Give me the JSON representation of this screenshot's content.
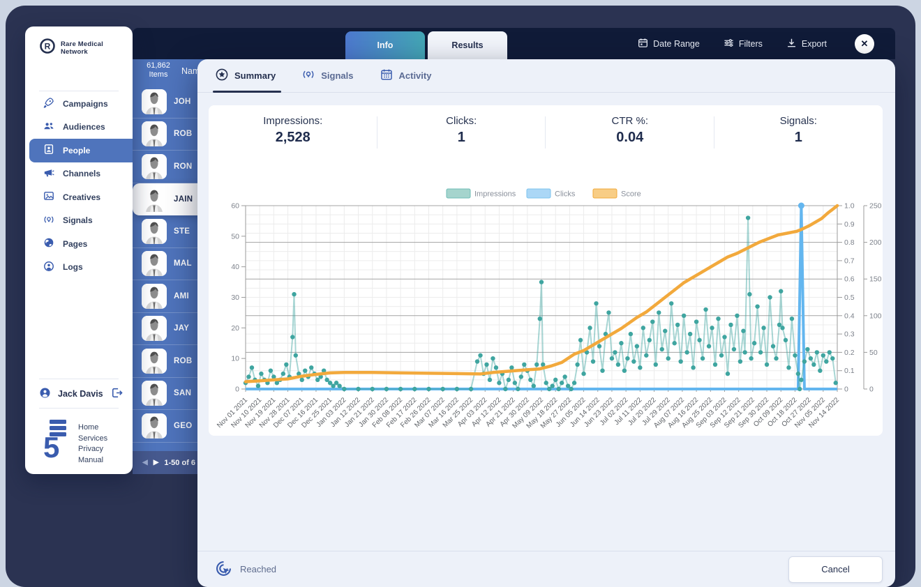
{
  "app": {
    "brand": "Rare Medical Network",
    "user_name": "Jack Davis",
    "footer_links": [
      "Home",
      "Services",
      "Privacy",
      "Manual"
    ],
    "accent_blue": "#4f74bc",
    "dark_navy": "#101b38"
  },
  "sidebar": {
    "items": [
      {
        "label": "Campaigns",
        "icon": "rocket-icon",
        "active": false
      },
      {
        "label": "Audiences",
        "icon": "audiences-icon",
        "active": false
      },
      {
        "label": "People",
        "icon": "people-badge-icon",
        "active": true
      },
      {
        "label": "Channels",
        "icon": "megaphone-icon",
        "active": false
      },
      {
        "label": "Creatives",
        "icon": "image-icon",
        "active": false
      },
      {
        "label": "Signals",
        "icon": "lightbulb-icon",
        "active": false
      },
      {
        "label": "Pages",
        "icon": "globe-icon",
        "active": false
      },
      {
        "label": "Logs",
        "icon": "person-circle-icon",
        "active": false
      }
    ]
  },
  "people_list": {
    "items_count": "61,862",
    "items_label": "Items",
    "column_header": "Nam",
    "rows": [
      {
        "name": "JOH",
        "selected": false
      },
      {
        "name": "ROB",
        "selected": false
      },
      {
        "name": "RON",
        "selected": false
      },
      {
        "name": "JAIN",
        "selected": true
      },
      {
        "name": "STE",
        "selected": false
      },
      {
        "name": "MAL",
        "selected": false
      },
      {
        "name": "AMI",
        "selected": false
      },
      {
        "name": "JAY",
        "selected": false
      },
      {
        "name": "ROB",
        "selected": false
      },
      {
        "name": "SAN",
        "selected": false
      },
      {
        "name": "GEO",
        "selected": false
      }
    ],
    "pagination": "1-50 of 6"
  },
  "header": {
    "tabs": [
      {
        "label": "Info",
        "active": true
      },
      {
        "label": "Results",
        "active": false
      }
    ],
    "actions": [
      {
        "label": "Date Range",
        "icon": "calendar-icon"
      },
      {
        "label": "Filters",
        "icon": "filters-icon"
      },
      {
        "label": "Export",
        "icon": "download-icon"
      }
    ],
    "close_glyph": "✕"
  },
  "results_panel": {
    "tabs": [
      {
        "label": "Summary",
        "icon": "star-badge-icon",
        "active": true
      },
      {
        "label": "Signals",
        "icon": "lightbulb-icon",
        "active": false
      },
      {
        "label": "Activity",
        "icon": "calendar-grid-icon",
        "active": false
      }
    ],
    "stats": [
      {
        "label": "Impressions:",
        "value": "2,528"
      },
      {
        "label": "Clicks:",
        "value": "1"
      },
      {
        "label": "CTR %:",
        "value": "0.04"
      },
      {
        "label": "Signals:",
        "value": "1"
      }
    ],
    "footer": {
      "status_label": "Reached",
      "cancel_label": "Cancel"
    }
  },
  "chart_data": {
    "type": "line",
    "x_domain_days": [
      0,
      378
    ],
    "x_tick_labels": [
      "Nov 01 2021",
      "Nov 10 2021",
      "Nov 19 2021",
      "Nov 28 2021",
      "Dec 07 2021",
      "Dec 16 2021",
      "Dec 25 2021",
      "Jan 03 2022",
      "Jan 12 2022",
      "Jan 21 2022",
      "Jan 30 2022",
      "Feb 08 2022",
      "Feb 17 2022",
      "Feb 26 2022",
      "Mar 07 2022",
      "Mar 16 2022",
      "Mar 25 2022",
      "Apr 03 2022",
      "Apr 12 2022",
      "Apr 21 2022",
      "Apr 30 2022",
      "May 09 2022",
      "May 18 2022",
      "May 27 2022",
      "Jun 05 2022",
      "Jun 14 2022",
      "Jun 23 2022",
      "Jul 02 2022",
      "Jul 11 2022",
      "Jul 20 2022",
      "Jul 29 2022",
      "Aug 07 2022",
      "Aug 16 2022",
      "Aug 25 2022",
      "Sep 03 2022",
      "Sep 12 2022",
      "Sep 21 2022",
      "Sep 30 2022",
      "Oct 09 2022",
      "Oct 18 2022",
      "Oct 27 2022",
      "Nov 05 2022",
      "Nov 14 2022"
    ],
    "axes": {
      "left": {
        "min": 0,
        "max": 60,
        "tick_labels": [
          "0",
          "10",
          "20",
          "30",
          "40",
          "50",
          "60"
        ]
      },
      "right_score": {
        "min": 0,
        "max": 1,
        "tick_labels": [
          "0",
          "0.1",
          "0.2",
          "0.3",
          "0.4",
          "0.5",
          "0.6",
          "0.7",
          "0.8",
          "0.9",
          "1.0"
        ]
      },
      "right_outer": {
        "min": 0,
        "max": 250,
        "tick_labels": [
          "0",
          "50",
          "100",
          "150",
          "200",
          "250"
        ]
      }
    },
    "grid": {
      "h_light_step": 0.05,
      "h_dark_levels": [
        0.2,
        0.4,
        0.6,
        0.8,
        1.0
      ]
    },
    "legend": [
      {
        "name": "Impressions",
        "fill": "#a5d4cd",
        "stroke": "#6fbdb6"
      },
      {
        "name": "Clicks",
        "fill": "#abd7f6",
        "stroke": "#7cc3ee"
      },
      {
        "name": "Score",
        "fill": "#f8cd85",
        "stroke": "#f0a93a"
      }
    ],
    "series": {
      "impressions": {
        "axis": "left",
        "dot_color": "#3fa5a0",
        "line_color": "rgba(63,165,160,0.45)",
        "points": [
          [
            0,
            2
          ],
          [
            2,
            4
          ],
          [
            4,
            7
          ],
          [
            6,
            3
          ],
          [
            8,
            1
          ],
          [
            10,
            5
          ],
          [
            12,
            3
          ],
          [
            14,
            2
          ],
          [
            16,
            6
          ],
          [
            18,
            4
          ],
          [
            20,
            2
          ],
          [
            22,
            3
          ],
          [
            24,
            5
          ],
          [
            26,
            8
          ],
          [
            28,
            4
          ],
          [
            30,
            17
          ],
          [
            31,
            31
          ],
          [
            32,
            11
          ],
          [
            34,
            5
          ],
          [
            36,
            3
          ],
          [
            38,
            6
          ],
          [
            40,
            4
          ],
          [
            42,
            7
          ],
          [
            44,
            5
          ],
          [
            46,
            3
          ],
          [
            48,
            4
          ],
          [
            50,
            6
          ],
          [
            52,
            3
          ],
          [
            54,
            2
          ],
          [
            56,
            1
          ],
          [
            58,
            2
          ],
          [
            60,
            1
          ],
          [
            63,
            0
          ],
          [
            72,
            0
          ],
          [
            81,
            0
          ],
          [
            90,
            0
          ],
          [
            99,
            0
          ],
          [
            108,
            0
          ],
          [
            117,
            0
          ],
          [
            126,
            0
          ],
          [
            135,
            0
          ],
          [
            144,
            0
          ],
          [
            148,
            9
          ],
          [
            150,
            11
          ],
          [
            152,
            5
          ],
          [
            154,
            8
          ],
          [
            156,
            3
          ],
          [
            158,
            10
          ],
          [
            160,
            7
          ],
          [
            162,
            2
          ],
          [
            164,
            5
          ],
          [
            166,
            0
          ],
          [
            168,
            3
          ],
          [
            170,
            7
          ],
          [
            172,
            2
          ],
          [
            174,
            0
          ],
          [
            176,
            4
          ],
          [
            178,
            8
          ],
          [
            180,
            6
          ],
          [
            182,
            3
          ],
          [
            184,
            1
          ],
          [
            186,
            8
          ],
          [
            188,
            23
          ],
          [
            189,
            35
          ],
          [
            190,
            8
          ],
          [
            192,
            2
          ],
          [
            194,
            0
          ],
          [
            196,
            1
          ],
          [
            198,
            3
          ],
          [
            200,
            0
          ],
          [
            202,
            2
          ],
          [
            204,
            4
          ],
          [
            206,
            1
          ],
          [
            208,
            0
          ],
          [
            210,
            2
          ],
          [
            212,
            8
          ],
          [
            214,
            16
          ],
          [
            216,
            5
          ],
          [
            218,
            12
          ],
          [
            220,
            20
          ],
          [
            222,
            9
          ],
          [
            224,
            28
          ],
          [
            226,
            14
          ],
          [
            228,
            6
          ],
          [
            230,
            18
          ],
          [
            232,
            25
          ],
          [
            234,
            10
          ],
          [
            236,
            12
          ],
          [
            238,
            8
          ],
          [
            240,
            15
          ],
          [
            242,
            6
          ],
          [
            244,
            10
          ],
          [
            246,
            18
          ],
          [
            248,
            9
          ],
          [
            250,
            14
          ],
          [
            252,
            7
          ],
          [
            254,
            20
          ],
          [
            256,
            11
          ],
          [
            258,
            16
          ],
          [
            260,
            22
          ],
          [
            262,
            8
          ],
          [
            264,
            25
          ],
          [
            266,
            13
          ],
          [
            268,
            19
          ],
          [
            270,
            10
          ],
          [
            272,
            28
          ],
          [
            274,
            15
          ],
          [
            276,
            21
          ],
          [
            278,
            9
          ],
          [
            280,
            24
          ],
          [
            282,
            12
          ],
          [
            284,
            18
          ],
          [
            286,
            7
          ],
          [
            288,
            22
          ],
          [
            290,
            16
          ],
          [
            292,
            10
          ],
          [
            294,
            26
          ],
          [
            296,
            14
          ],
          [
            298,
            20
          ],
          [
            300,
            8
          ],
          [
            302,
            23
          ],
          [
            304,
            11
          ],
          [
            306,
            17
          ],
          [
            308,
            5
          ],
          [
            310,
            21
          ],
          [
            312,
            13
          ],
          [
            314,
            24
          ],
          [
            316,
            9
          ],
          [
            318,
            19
          ],
          [
            319,
            12
          ],
          [
            321,
            56
          ],
          [
            322,
            31
          ],
          [
            323,
            10
          ],
          [
            325,
            15
          ],
          [
            327,
            27
          ],
          [
            329,
            12
          ],
          [
            331,
            20
          ],
          [
            333,
            8
          ],
          [
            335,
            30
          ],
          [
            337,
            14
          ],
          [
            339,
            10
          ],
          [
            341,
            21
          ],
          [
            342,
            32
          ],
          [
            343,
            20
          ],
          [
            345,
            16
          ],
          [
            347,
            7
          ],
          [
            349,
            23
          ],
          [
            351,
            11
          ],
          [
            353,
            5
          ],
          [
            354,
            0
          ],
          [
            355,
            3
          ],
          [
            357,
            9
          ],
          [
            359,
            13
          ],
          [
            361,
            10
          ],
          [
            363,
            8
          ],
          [
            365,
            12
          ],
          [
            367,
            6
          ],
          [
            369,
            11
          ],
          [
            371,
            9
          ],
          [
            373,
            12
          ],
          [
            375,
            10
          ],
          [
            377,
            2
          ]
        ]
      },
      "clicks": {
        "axis": "right_score",
        "line_color": "#63b6ef",
        "points": [
          [
            0,
            0
          ],
          [
            353,
            0
          ],
          [
            355,
            1
          ],
          [
            357,
            0
          ],
          [
            378,
            0
          ]
        ],
        "spike_day": 355
      },
      "score": {
        "axis": "right_score",
        "line_color": "#f2a93c",
        "points": [
          [
            0,
            0.04
          ],
          [
            9,
            0.045
          ],
          [
            18,
            0.05
          ],
          [
            27,
            0.055
          ],
          [
            36,
            0.07
          ],
          [
            45,
            0.08
          ],
          [
            54,
            0.088
          ],
          [
            63,
            0.09
          ],
          [
            81,
            0.09
          ],
          [
            99,
            0.088
          ],
          [
            117,
            0.086
          ],
          [
            135,
            0.084
          ],
          [
            150,
            0.082
          ],
          [
            158,
            0.09
          ],
          [
            165,
            0.095
          ],
          [
            172,
            0.1
          ],
          [
            180,
            0.105
          ],
          [
            188,
            0.11
          ],
          [
            195,
            0.125
          ],
          [
            202,
            0.145
          ],
          [
            210,
            0.19
          ],
          [
            216,
            0.21
          ],
          [
            222,
            0.24
          ],
          [
            228,
            0.27
          ],
          [
            234,
            0.3
          ],
          [
            240,
            0.33
          ],
          [
            245,
            0.36
          ],
          [
            250,
            0.39
          ],
          [
            256,
            0.42
          ],
          [
            262,
            0.46
          ],
          [
            268,
            0.5
          ],
          [
            274,
            0.54
          ],
          [
            280,
            0.58
          ],
          [
            284,
            0.6
          ],
          [
            290,
            0.63
          ],
          [
            296,
            0.66
          ],
          [
            302,
            0.69
          ],
          [
            308,
            0.72
          ],
          [
            314,
            0.74
          ],
          [
            321,
            0.77
          ],
          [
            328,
            0.8
          ],
          [
            334,
            0.82
          ],
          [
            340,
            0.84
          ],
          [
            346,
            0.85
          ],
          [
            352,
            0.86
          ],
          [
            355,
            0.87
          ],
          [
            360,
            0.89
          ],
          [
            364,
            0.91
          ],
          [
            368,
            0.93
          ],
          [
            372,
            0.96
          ],
          [
            375,
            0.98
          ],
          [
            378,
            1.0
          ]
        ]
      }
    }
  }
}
